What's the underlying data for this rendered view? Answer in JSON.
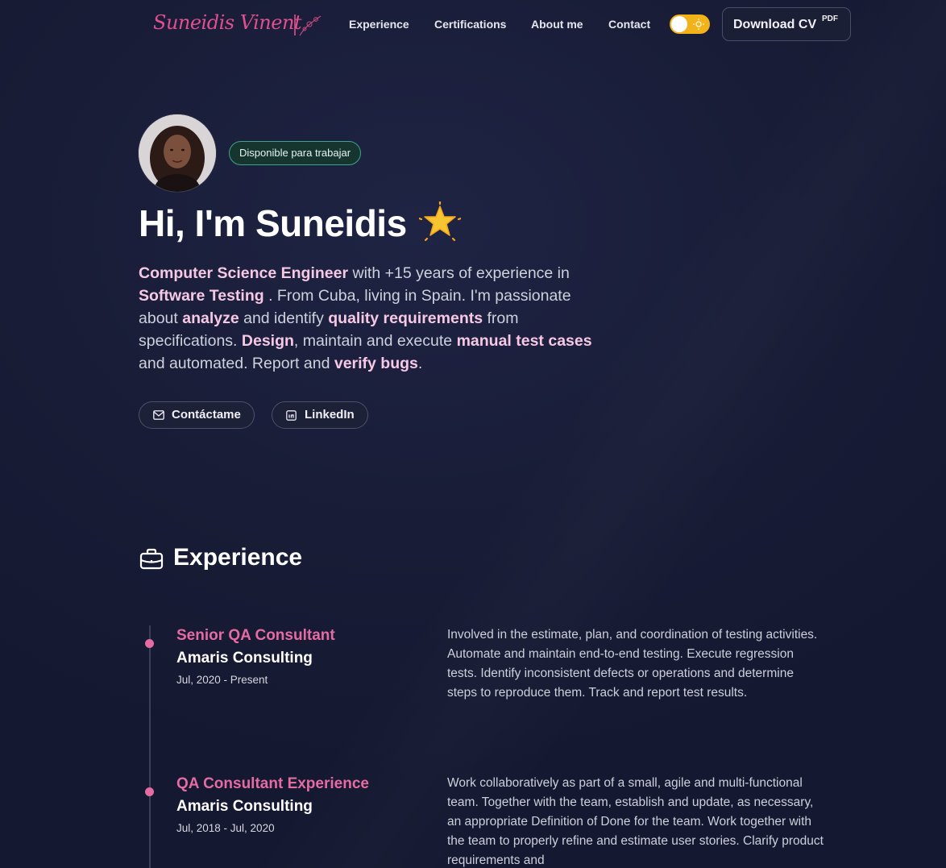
{
  "nav": {
    "logo_text": "Suneidis Vinent",
    "links": [
      "Experience",
      "Certifications",
      "About me",
      "Contact"
    ],
    "download_label": "Download CV",
    "download_sup": "PDF"
  },
  "hero": {
    "badge": "Disponible para trabajar",
    "title": "Hi, I'm Suneidis",
    "bio": [
      {
        "t": "Computer Science Engineer",
        "b": true
      },
      {
        "t": " with +15 years of experience in ",
        "b": false
      },
      {
        "t": "Software Testing",
        "b": true
      },
      {
        "t": " . From Cuba, living in Spain. I'm passionate about ",
        "b": false
      },
      {
        "t": "analyze",
        "b": true
      },
      {
        "t": " and identify ",
        "b": false
      },
      {
        "t": "quality requirements",
        "b": true
      },
      {
        "t": " from specifications. ",
        "b": false
      },
      {
        "t": "Design",
        "b": true
      },
      {
        "t": ", maintain and execute ",
        "b": false
      },
      {
        "t": "manual test cases",
        "b": true
      },
      {
        "t": " and automated. Report and ",
        "b": false
      },
      {
        "t": "verify bugs",
        "b": true
      },
      {
        "t": ".",
        "b": false
      }
    ],
    "buttons": [
      "Contáctame",
      "LinkedIn"
    ]
  },
  "experience": {
    "title": "Experience",
    "jobs": [
      {
        "role": "Senior QA Consultant",
        "company": "Amaris Consulting",
        "date": "Jul, 2020 - Present",
        "description": "Involved in the estimate, plan, and coordination of testing activities. Automate and maintain end-to-end testing. Execute regression tests. Identify inconsistent defects or operations and determine steps to reproduce them. Track and report test results."
      },
      {
        "role": "QA Consultant Experience",
        "company": "Amaris Consulting",
        "date": "Jul, 2018 - Jul, 2020",
        "description": "Work collaboratively as part of a small, agile and multi-functional team. Together with the team, establish and update, as necessary, an appropriate Definition of Done for the team. Work together with the team to properly refine and estimate user stories. Clarify product requirements and"
      }
    ]
  },
  "colors": {
    "accent_pink": "#e56ba3",
    "badge_green": "#3aa58a",
    "toggle_yellow": "#f2b31a",
    "background": "#161a33"
  },
  "icons": {
    "hero_emoji": "glowing-star-icon",
    "experience": "briefcase-icon",
    "contact": "mail-icon",
    "linkedin": "linkedin-icon",
    "toggle": "sun-icon"
  }
}
